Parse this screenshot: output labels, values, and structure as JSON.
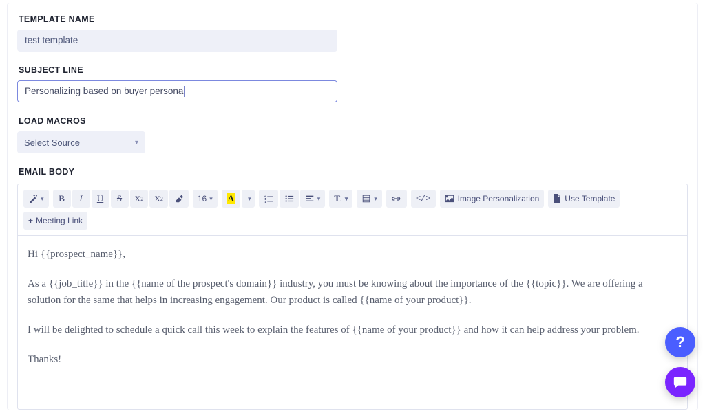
{
  "labels": {
    "template_name": "TEMPLATE NAME",
    "subject_line": "SUBJECT LINE",
    "load_macros": "LOAD MACROS",
    "email_body": "EMAIL BODY"
  },
  "fields": {
    "template_name_value": "test template",
    "subject_line_value": "Personalizing based on buyer persona",
    "macro_placeholder": "Select Source"
  },
  "toolbar": {
    "font_size": "16",
    "color_letter": "A",
    "paragraph_letter": "T",
    "image_personalization": "Image Personalization",
    "use_template": "Use Template",
    "meeting_link": "Meeting Link"
  },
  "body": {
    "p1": "Hi {{prospect_name}},",
    "p2": "As a {{job_title}} in the {{name of the prospect's domain}} industry, you must be knowing about the importance of the {{topic}}. We are offering a solution for the same that helps in increasing engagement. Our product is called {{name of your product}}.",
    "p3": "I will be delighted to schedule a quick call this week to explain the features of {{name of your product}} and how it can help address your problem.",
    "p4": "Thanks!"
  },
  "fab": {
    "help_label": "?"
  }
}
